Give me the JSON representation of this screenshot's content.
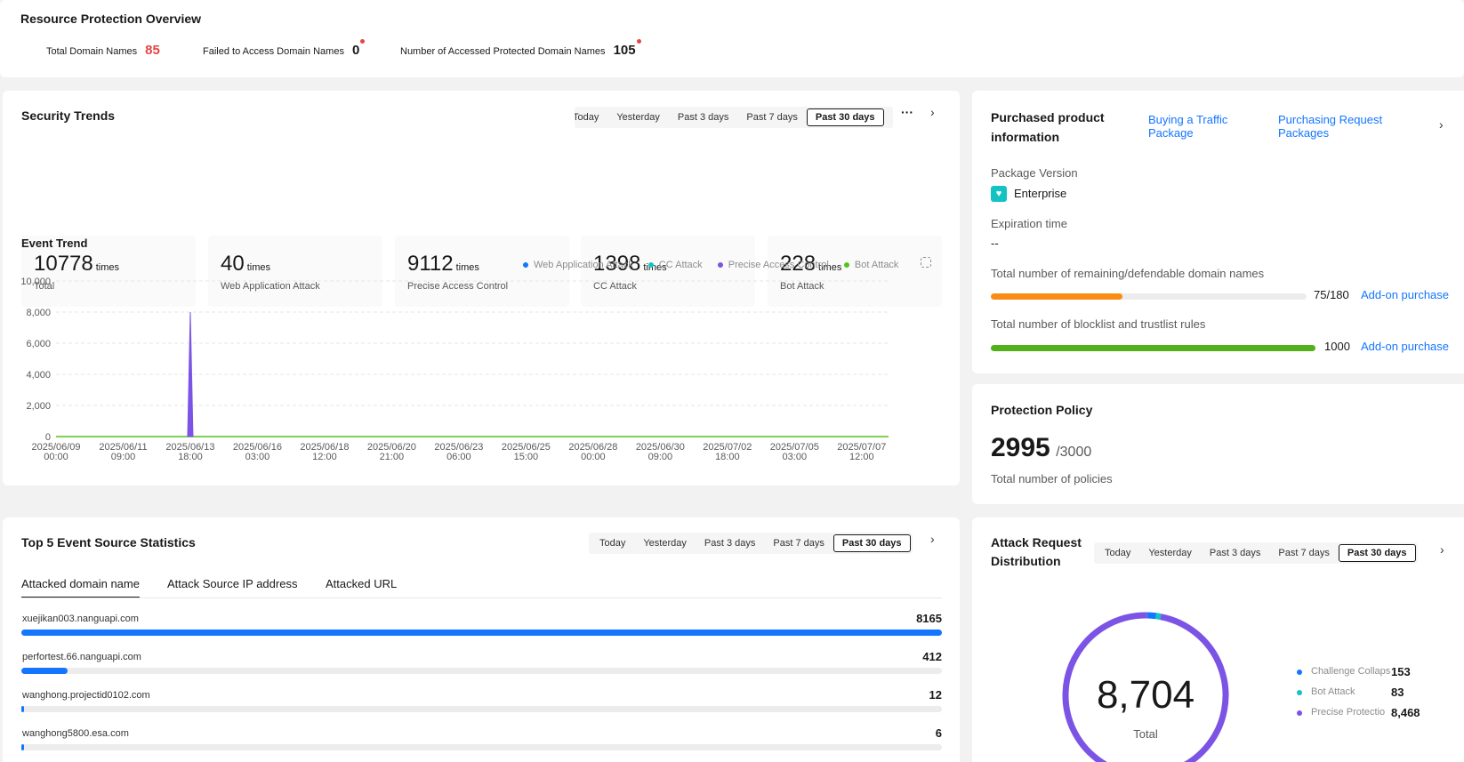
{
  "overview": {
    "title": "Resource Protection Overview",
    "total_label": "Total Domain Names",
    "total_value": "85",
    "failed_label": "Failed to Access Domain Names",
    "failed_value": "0",
    "accessed_label": "Number of Accessed Protected Domain Names",
    "accessed_value": "105"
  },
  "security": {
    "title": "Security Trends",
    "periods": [
      "Today",
      "Yesterday",
      "Past 3 days",
      "Past 7 days",
      "Past 30 days"
    ],
    "active_period": "Past 30 days",
    "more_icon": "more-icon",
    "stats": [
      {
        "value": "10778",
        "unit": "times",
        "label": "Total"
      },
      {
        "value": "40",
        "unit": "times",
        "label": "Web Application Attack"
      },
      {
        "value": "9112",
        "unit": "times",
        "label": "Precise Access Control"
      },
      {
        "value": "1398",
        "unit": "times",
        "label": "CC Attack"
      },
      {
        "value": "228",
        "unit": "times",
        "label": "Bot Attack"
      }
    ],
    "event_trend_title": "Event Trend"
  },
  "chart_data": {
    "type": "line",
    "title": "Event Trend",
    "x": [
      "2025/06/09 00:00",
      "2025/06/11 09:00",
      "2025/06/13 18:00",
      "2025/06/16 03:00",
      "2025/06/18 12:00",
      "2025/06/20 21:00",
      "2025/06/23 06:00",
      "2025/06/25 15:00",
      "2025/06/28 00:00",
      "2025/06/30 09:00",
      "2025/07/02 18:00",
      "2025/07/05 03:00",
      "2025/07/07 12:00"
    ],
    "x_ticks": [
      [
        "2025/06/09",
        "00:00"
      ],
      [
        "2025/06/11",
        "09:00"
      ],
      [
        "2025/06/13",
        "18:00"
      ],
      [
        "2025/06/16",
        "03:00"
      ],
      [
        "2025/06/18",
        "12:00"
      ],
      [
        "2025/06/20",
        "21:00"
      ],
      [
        "2025/06/23",
        "06:00"
      ],
      [
        "2025/06/25",
        "15:00"
      ],
      [
        "2025/06/28",
        "00:00"
      ],
      [
        "2025/06/30",
        "09:00"
      ],
      [
        "2025/07/02",
        "18:00"
      ],
      [
        "2025/07/05",
        "03:00"
      ],
      [
        "2025/07/07",
        "12:00"
      ]
    ],
    "y_ticks": [
      "10,000",
      "8,000",
      "6,000",
      "4,000",
      "2,000",
      "0"
    ],
    "ylim": [
      0,
      10000
    ],
    "spike": {
      "x": "2025/06/13 18:00",
      "y": 8000,
      "series": "Precise Access Control"
    },
    "series": [
      {
        "name": "Web Application Attack",
        "color": "#1476ff"
      },
      {
        "name": "CC Attack",
        "color": "#13c2c2"
      },
      {
        "name": "Precise Access Control",
        "color": "#7b54e5"
      },
      {
        "name": "Bot Attack",
        "color": "#52c41a"
      }
    ],
    "legend_placement": "top-right",
    "grid": true
  },
  "purchased": {
    "title_line1": "Purchased product",
    "title_line2": "information",
    "link1_line1": "Buying a Traffic",
    "link1_line2": "Package",
    "link2_line1": "Purchasing Request",
    "link2_line2": "Packages",
    "package_label": "Package Version",
    "package_value": "Enterprise",
    "expiration_label": "Expiration time",
    "expiration_value": "--",
    "domains_label": "Total number of remaining/defendable domain names",
    "domains_value": "75/180",
    "domains_fraction": 0.4167,
    "domains_color": "#fa8c16",
    "rules_label": "Total number of blocklist and trustlist rules",
    "rules_value": "1000",
    "rules_fraction": 1.0,
    "rules_color": "#52b11a",
    "addon_label": "Add-on purchase"
  },
  "policy": {
    "title": "Protection Policy",
    "count": "2995",
    "total": "/3000",
    "caption": "Total number of policies"
  },
  "top5": {
    "title": "Top 5 Event Source Statistics",
    "periods": [
      "Today",
      "Yesterday",
      "Past 3 days",
      "Past 7 days",
      "Past 30 days"
    ],
    "active_period": "Past 30 days",
    "tabs": [
      "Attacked domain name",
      "Attack Source IP address",
      "Attacked URL"
    ],
    "rows": [
      {
        "name": "xuejikan003.nanguapi.com",
        "count": "8165",
        "fraction": 1.0
      },
      {
        "name": "perfortest.66.nanguapi.com",
        "count": "412",
        "fraction": 0.0505
      },
      {
        "name": "wanghong.projectid0102.com",
        "count": "12",
        "fraction": 0.0015
      },
      {
        "name": "wanghong5800.esa.com",
        "count": "6",
        "fraction": 0.0007
      }
    ]
  },
  "distribution": {
    "title_line1": "Attack Request",
    "title_line2": "Distribution",
    "periods": [
      "Today",
      "Yesterday",
      "Past 3 days",
      "Past 7 days",
      "Past 30 days"
    ],
    "active_period": "Past 30 days",
    "total_value": "8,704",
    "total_label": "Total",
    "legend": [
      {
        "name": "Challenge Collaps",
        "value": "153",
        "color": "#1476ff"
      },
      {
        "name": "Bot Attack",
        "value": "83",
        "color": "#13c2c2"
      },
      {
        "name": "Precise Protectio",
        "value": "8,468",
        "color": "#7b54e5"
      }
    ],
    "slices": [
      {
        "name": "Challenge Collaps",
        "value": 153,
        "color": "#1476ff"
      },
      {
        "name": "Bot Attack",
        "value": 83,
        "color": "#13c2c2"
      },
      {
        "name": "Precise Protectio",
        "value": 8468,
        "color": "#7b54e5"
      }
    ]
  }
}
